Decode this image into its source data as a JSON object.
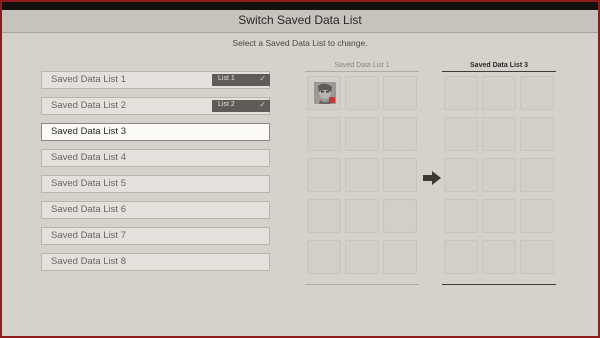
{
  "header": {
    "title": "Switch Saved Data List"
  },
  "instruction": "Select a Saved Data List to change.",
  "lists": [
    {
      "label": "Saved Data List 1",
      "badge": "List 1",
      "selected": false
    },
    {
      "label": "Saved Data List 2",
      "badge": "List 2",
      "selected": false
    },
    {
      "label": "Saved Data List 3",
      "badge": "",
      "selected": true
    },
    {
      "label": "Saved Data List 4",
      "badge": "",
      "selected": false
    },
    {
      "label": "Saved Data List 5",
      "badge": "",
      "selected": false
    },
    {
      "label": "Saved Data List 6",
      "badge": "",
      "selected": false
    },
    {
      "label": "Saved Data List 7",
      "badge": "",
      "selected": false
    },
    {
      "label": "Saved Data List 8",
      "badge": "",
      "selected": false
    }
  ],
  "panels": {
    "source": {
      "title": "Saved Data List 1"
    },
    "target": {
      "title": "Saved Data List 3"
    }
  },
  "icons": {
    "badge_check": "check-icon",
    "transfer": "arrow-right-icon",
    "thumbnail": "character-portrait"
  },
  "colors": {
    "frame": "#8e1c1c",
    "background": "#d5d1cb",
    "badge": "#5f5c58",
    "selected_item": "#fbfaf7"
  }
}
